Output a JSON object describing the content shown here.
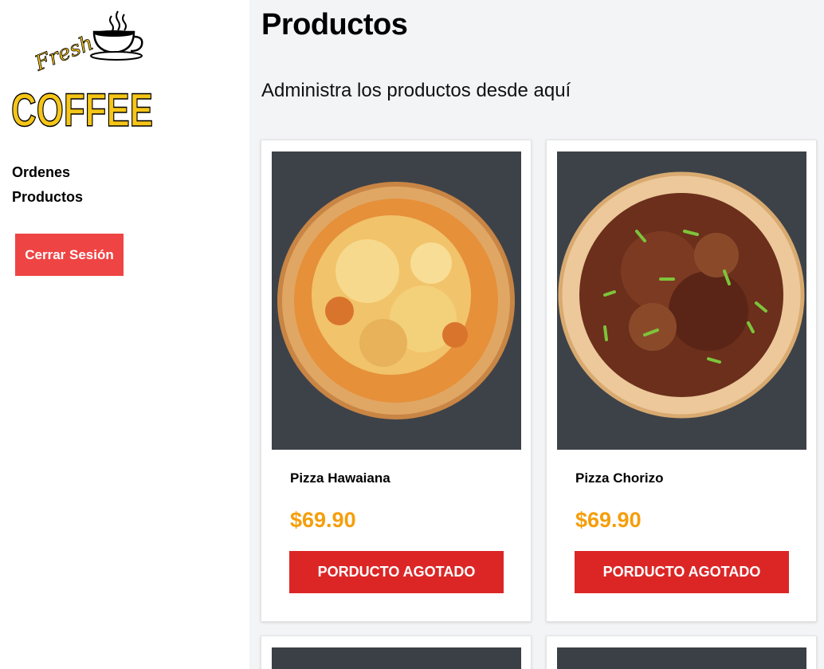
{
  "sidebar": {
    "logo_text": {
      "fresh": "Fresh",
      "coffee": "COFFEE"
    },
    "nav": [
      {
        "label": "Ordenes"
      },
      {
        "label": "Productos"
      }
    ],
    "logout_label": "Cerrar Sesión"
  },
  "main": {
    "title": "Productos",
    "subtitle": "Administra los productos desde aquí",
    "products": [
      {
        "name": "Pizza Hawaiana",
        "price": "$69.90",
        "status_label": "PORDUCTO AGOTADO"
      },
      {
        "name": "Pizza Chorizo",
        "price": "$69.90",
        "status_label": "PORDUCTO AGOTADO"
      }
    ]
  },
  "colors": {
    "accent_price": "#f59e0b",
    "logout_button": "#ef4444",
    "sold_out_button": "#dc2626",
    "logo_yellow": "#f5c518"
  }
}
